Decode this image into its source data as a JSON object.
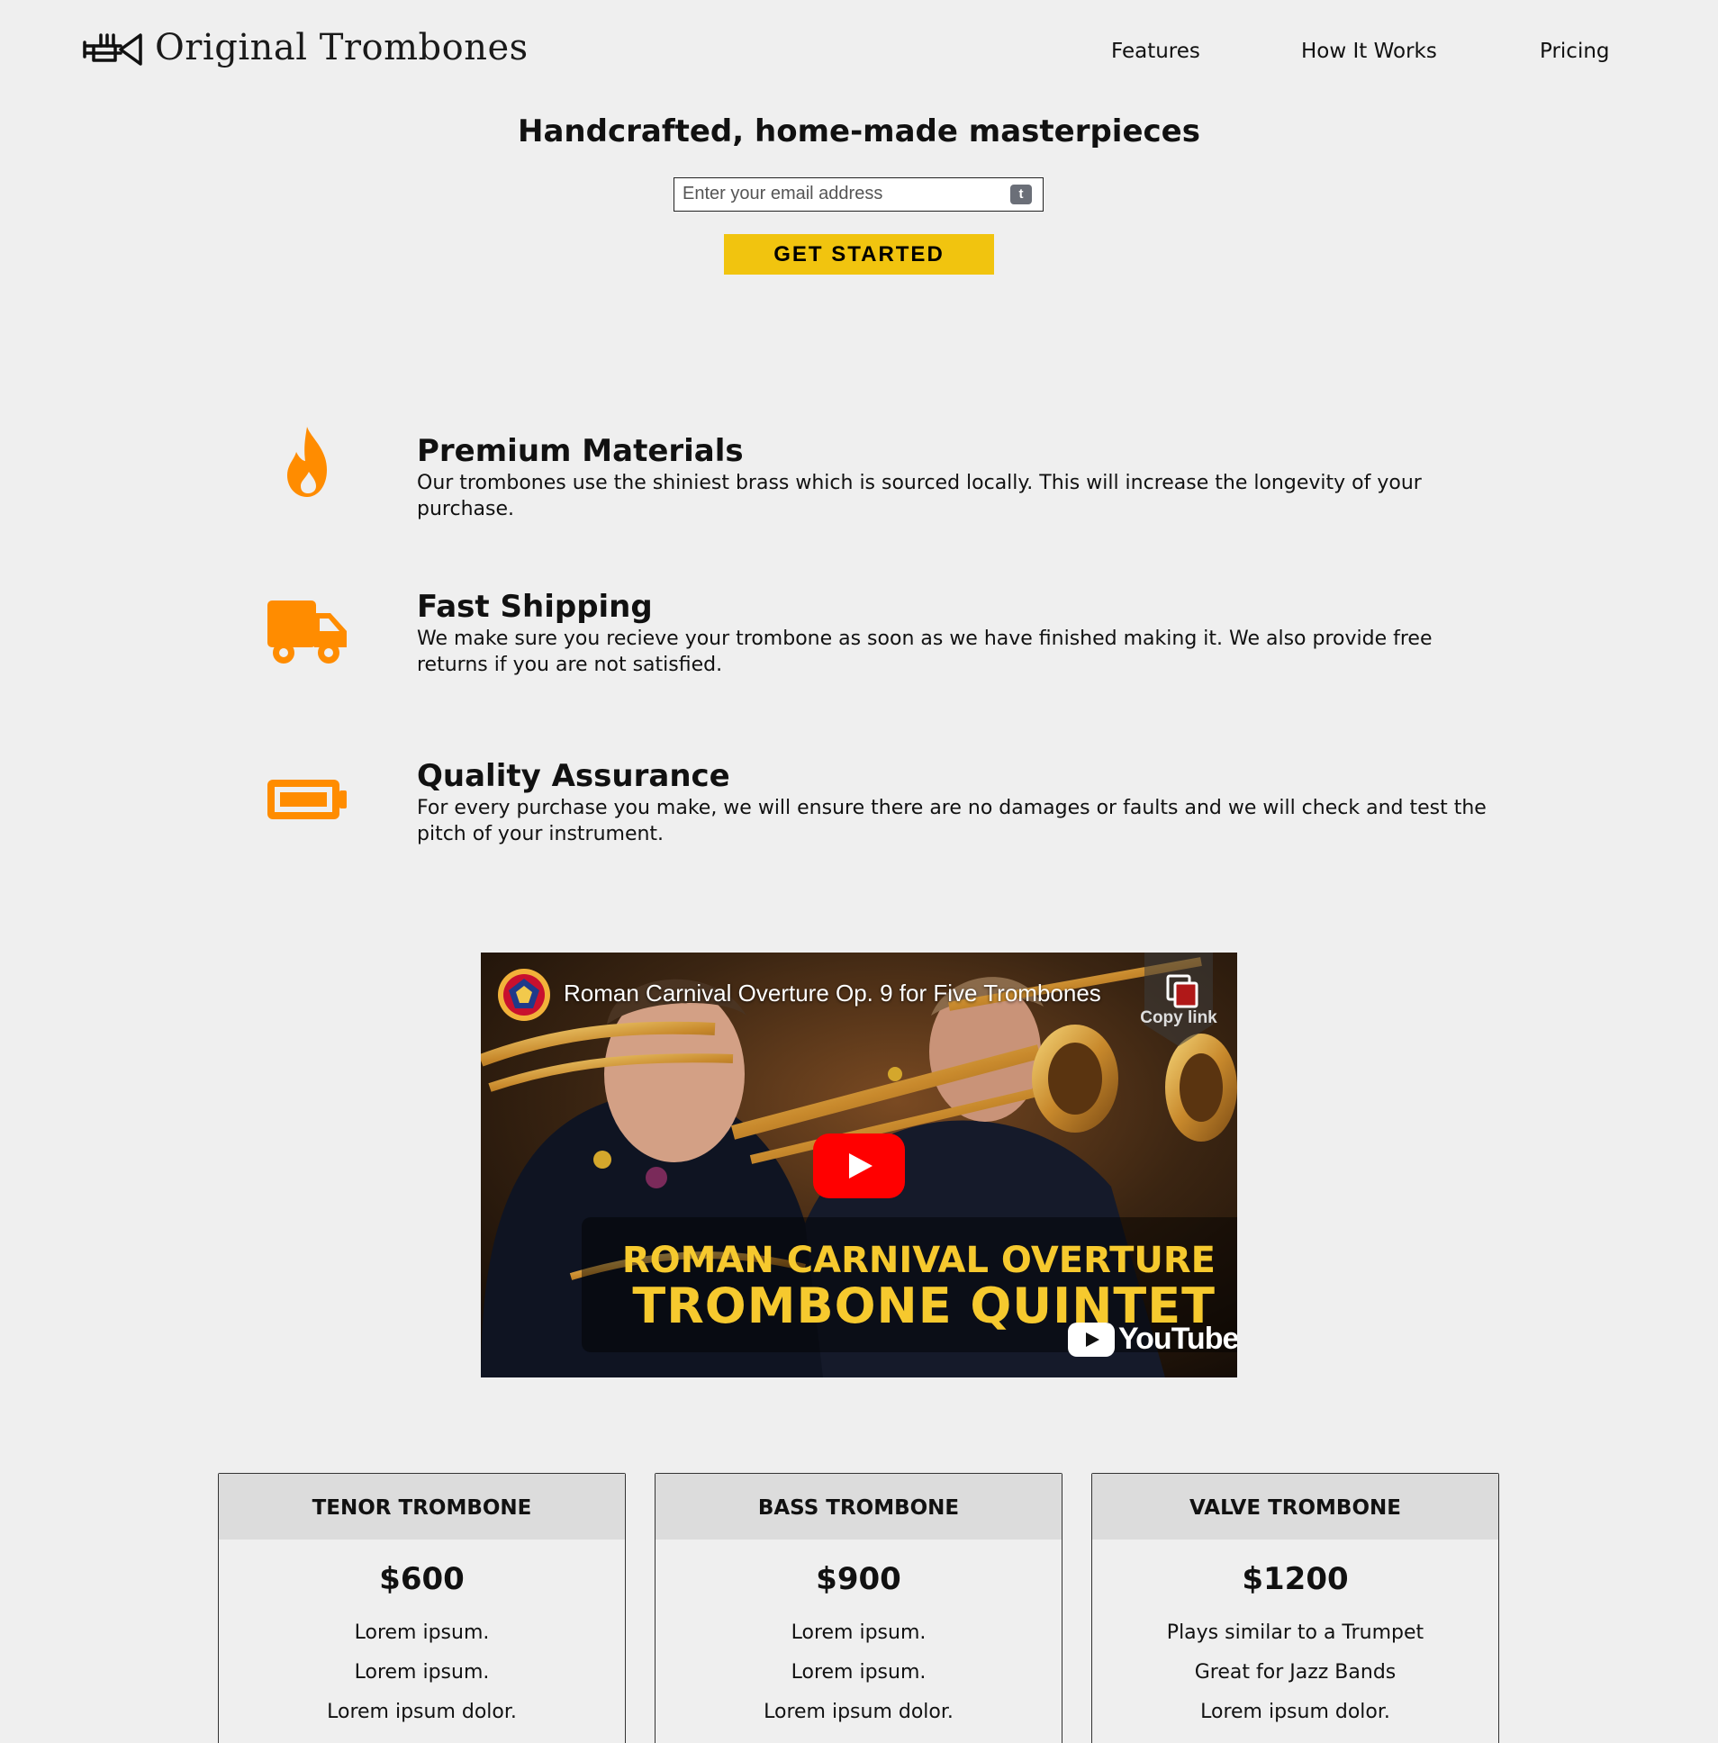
{
  "header": {
    "brand": "Original Trombones",
    "nav": [
      "Features",
      "How It Works",
      "Pricing"
    ]
  },
  "hero": {
    "title": "Handcrafted, home-made masterpieces",
    "email_placeholder": "Enter your email address",
    "email_badge": "t",
    "cta_label": "GET STARTED"
  },
  "features": [
    {
      "icon": "fire-icon",
      "title": "Premium Materials",
      "description": "Our trombones use the shiniest brass which is sourced locally. This will increase the longevity of your purchase."
    },
    {
      "icon": "truck-icon",
      "title": "Fast Shipping",
      "description": "We make sure you recieve your trombone as soon as we have finished making it. We also provide free returns if you are not satisfied."
    },
    {
      "icon": "battery-icon",
      "title": "Quality Assurance",
      "description": "For every purchase you make, we will ensure there are no damages or faults and we will check and test the pitch of your instrument."
    }
  ],
  "video": {
    "title": "Roman Carnival Overture Op. 9 for Five Trombones",
    "copy_link_label": "Copy link",
    "overlay_line1": "ROMAN CARNIVAL OVERTURE",
    "overlay_line2": "TROMBONE QUINTET",
    "provider": "YouTube"
  },
  "pricing": [
    {
      "name": "TENOR TROMBONE",
      "price": "$600",
      "features": [
        "Lorem ipsum.",
        "Lorem ipsum.",
        "Lorem ipsum dolor."
      ]
    },
    {
      "name": "BASS TROMBONE",
      "price": "$900",
      "features": [
        "Lorem ipsum.",
        "Lorem ipsum.",
        "Lorem ipsum dolor."
      ]
    },
    {
      "name": "VALVE TROMBONE",
      "price": "$1200",
      "features": [
        "Plays similar to a Trumpet",
        "Great for Jazz Bands",
        "Lorem ipsum dolor."
      ]
    }
  ],
  "colors": {
    "background": "#efefef",
    "accent_yellow": "#f1c40f",
    "icon_orange": "#ff8c00",
    "youtube_red": "#ff0000",
    "overlay_yellow": "#f6c92e",
    "card_header": "#dcdcdc"
  }
}
